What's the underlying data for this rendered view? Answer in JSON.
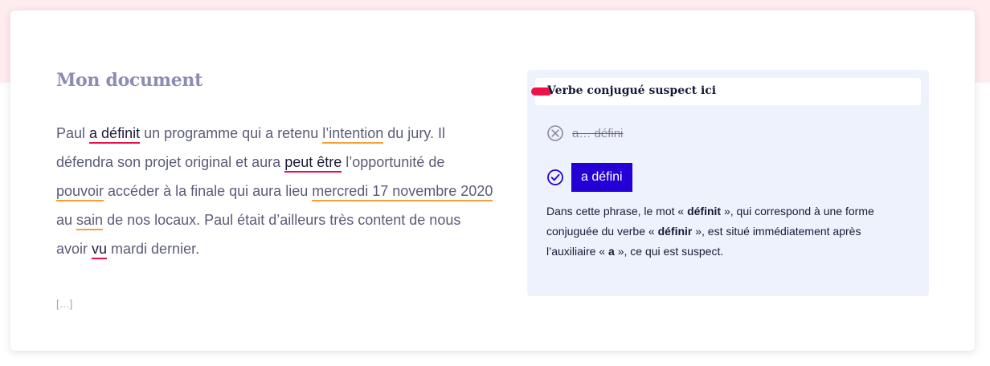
{
  "document": {
    "title": "Mon document",
    "text": {
      "s1": "Paul ",
      "u1": "a définit",
      "s2": " un programme qui a retenu ",
      "u2": "l’intention",
      "s3": " du jury. Il défendra son projet original et aura ",
      "u3": "peut être",
      "s4": " l’opportunité de ",
      "u4": "pouvoir",
      "s5": " accéder à la finale qui aura lieu ",
      "u5": "mercredi 17 novembre 2020",
      "s6": " au ",
      "u6": "sain",
      "s7": " de nos locaux. Paul était d’ailleurs très content de nous avoir ",
      "u7": "vu",
      "s8": " mardi dernier."
    },
    "ellipsis": "[…]"
  },
  "panel": {
    "header": "Verbe conjugué suspect ici",
    "reject_text": "a… défini",
    "accept_label": "a défini",
    "explanation": {
      "p1": "Dans cette phrase, le mot « ",
      "b1": "définit",
      "p2": " », qui correspond à une forme conjuguée du verbe « ",
      "b2": "définir",
      "p3": " », est situé immédiatement après l’auxiliaire « ",
      "b3": "a",
      "p4": " », ce qui est suspect."
    }
  },
  "colors": {
    "accent": "#2500d6",
    "error_underline": "#e8104a",
    "warning_underline": "#f2a13a",
    "title": "#8c8cb4",
    "panel_bg": "#eef2fd"
  },
  "icons": {
    "reject": "circle-x-icon",
    "accept": "circle-check-icon"
  }
}
